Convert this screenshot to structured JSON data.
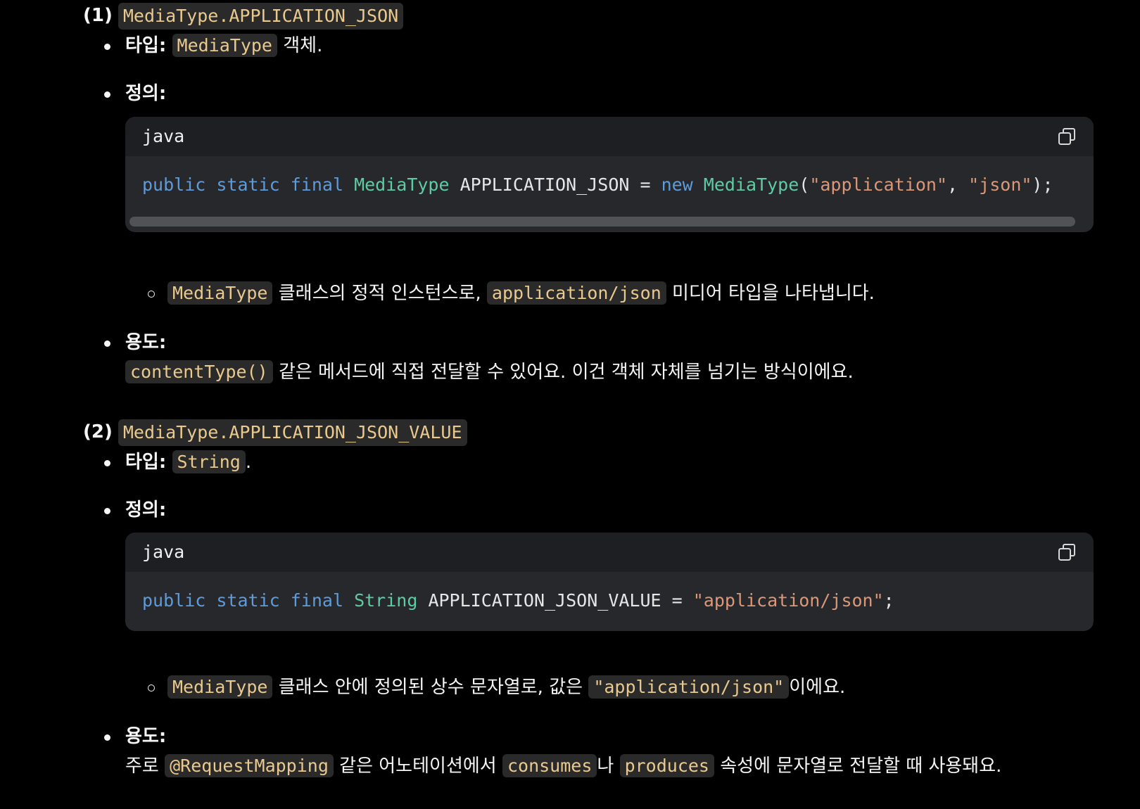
{
  "section1": {
    "number": "(1)",
    "title_code": "MediaType.APPLICATION_JSON",
    "type_label": "타입:",
    "type_code": "MediaType",
    "type_suffix": "객체.",
    "def_label": "정의:",
    "code_lang": "java",
    "code": {
      "kw1": "public",
      "kw2": "static",
      "kw3": "final",
      "type": "MediaType",
      "name": " APPLICATION_JSON = ",
      "kw4": "new",
      "ctor": "MediaType",
      "open": "(",
      "arg1": "\"application\"",
      "sep": ", ",
      "arg2": "\"json\"",
      "close": ");"
    },
    "sub_code1": "MediaType",
    "sub_text1": "클래스의 정적 인스턴스로,",
    "sub_code2": "application/json",
    "sub_text2": "미디어 타입을 나타냅니다.",
    "use_label": "용도:",
    "use_code": "contentType()",
    "use_text": "같은 메서드에 직접 전달할 수 있어요. 이건 객체 자체를 넘기는 방식이에요."
  },
  "section2": {
    "number": "(2)",
    "title_code": "MediaType.APPLICATION_JSON_VALUE",
    "type_label": "타입:",
    "type_code": "String",
    "type_suffix": ".",
    "def_label": "정의:",
    "code_lang": "java",
    "code": {
      "kw1": "public",
      "kw2": "static",
      "kw3": "final",
      "type": "String",
      "name": " APPLICATION_JSON_VALUE = ",
      "value": "\"application/json\"",
      "end": ";"
    },
    "sub_code1": "MediaType",
    "sub_text1": "클래스 안에 정의된 상수 문자열로, 값은",
    "sub_code2": "\"application/json\"",
    "sub_text2": "이에요.",
    "use_label": "용도:",
    "use_text1": "주로",
    "use_code1": "@RequestMapping",
    "use_text2": "같은 어노테이션에서",
    "use_code2": "consumes",
    "use_text3": "나",
    "use_code3": "produces",
    "use_text4": "속성에 문자열로 전달할 때 사용돼요."
  },
  "colors": {
    "background": "#000000",
    "inline_code_bg": "#2a2a2a",
    "inline_code_fg": "#e9c98e",
    "keyword": "#5f9bd8",
    "type": "#5fcba3",
    "string": "#d9987a"
  },
  "icons": {
    "copy": "copy-icon"
  }
}
